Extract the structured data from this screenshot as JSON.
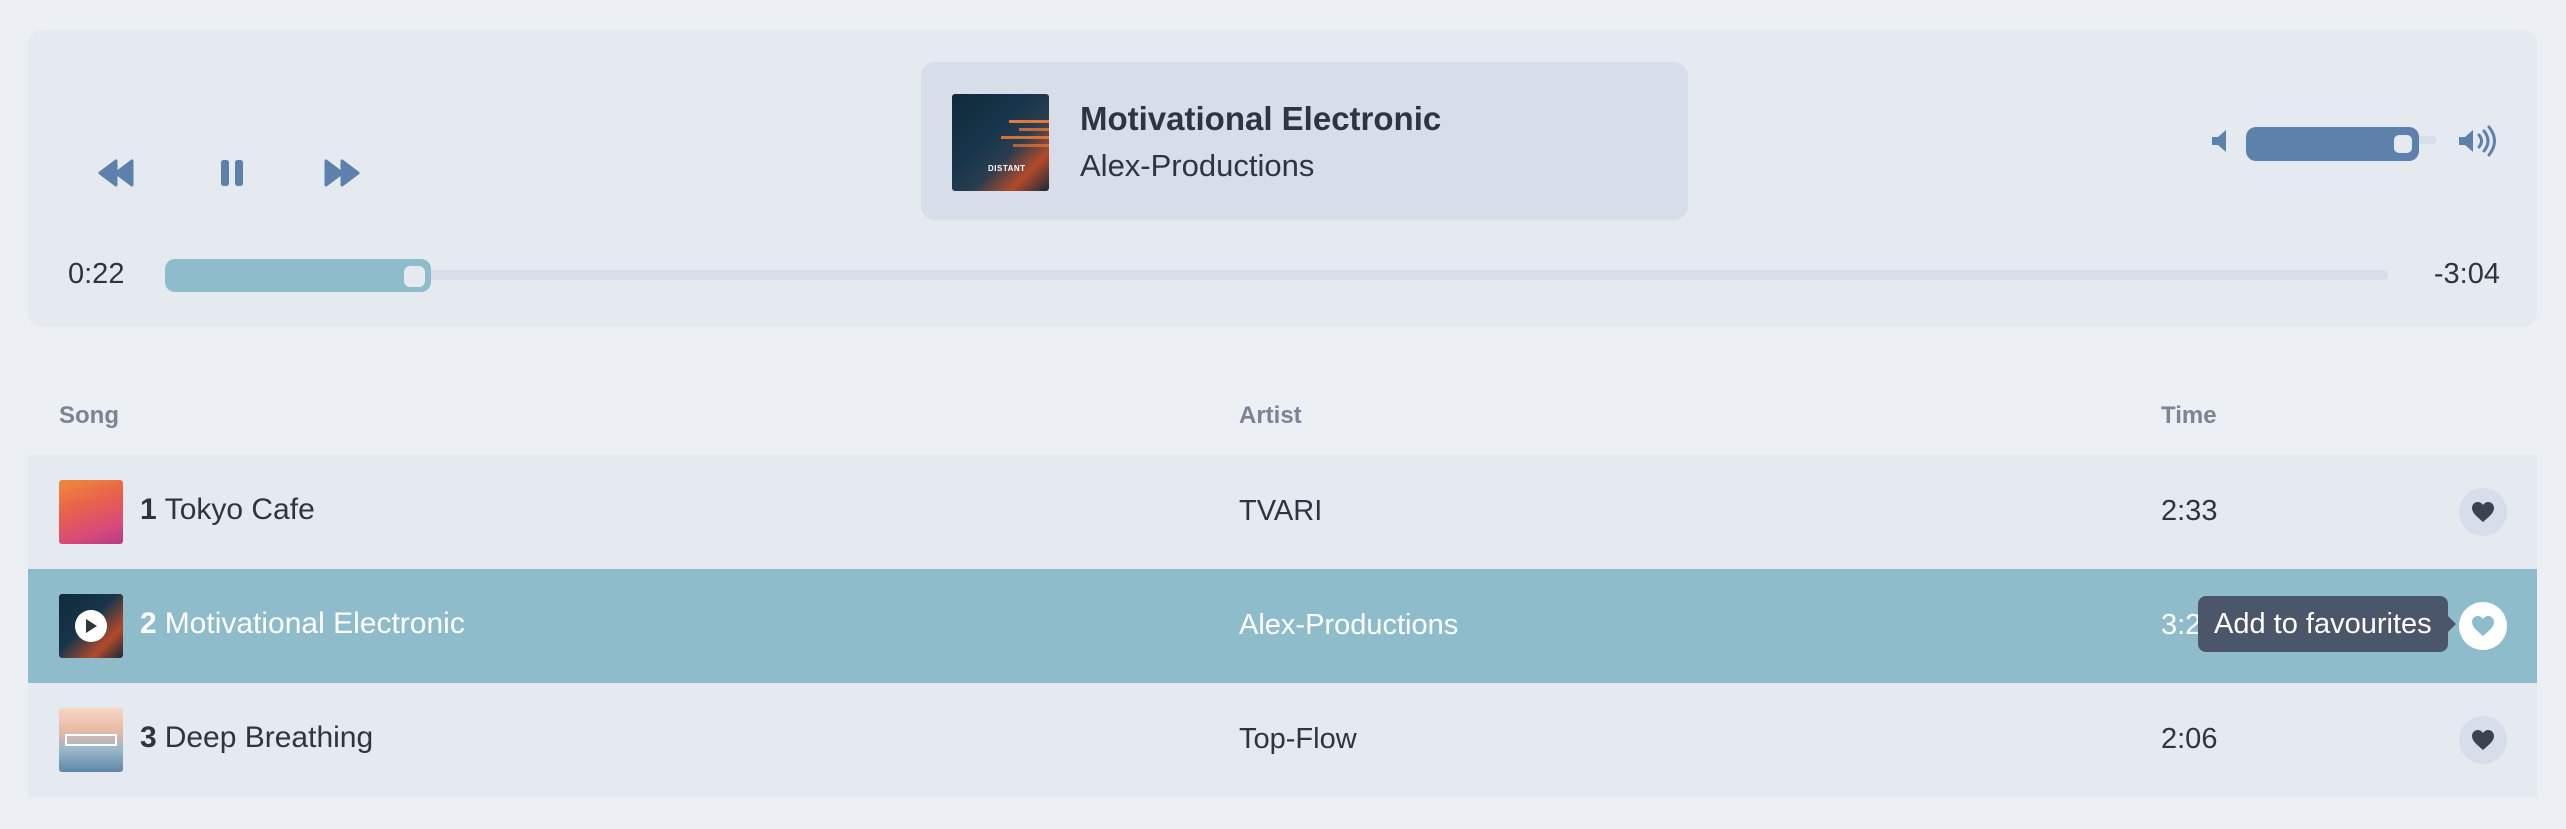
{
  "player": {
    "controls": {
      "prev_icon": "rewind-icon",
      "pause_icon": "pause-icon",
      "next_icon": "fast-forward-icon"
    },
    "now_playing": {
      "title": "Motivational Electronic",
      "artist": "Alex-Productions",
      "cover_text": "DISTANT"
    },
    "volume": {
      "level": 0.86,
      "low_icon": "volume-low-icon",
      "high_icon": "volume-high-icon"
    },
    "progress": {
      "elapsed": "0:22",
      "remaining": "-3:04",
      "fraction": 0.107
    }
  },
  "table": {
    "headers": {
      "song": "Song",
      "artist": "Artist",
      "time": "Time"
    },
    "rows": [
      {
        "number": "1",
        "title": "Tokyo Cafe",
        "artist": "TVARI",
        "time": "2:33",
        "active": false
      },
      {
        "number": "2",
        "title": "Motivational Electronic",
        "artist": "Alex-Productions",
        "time": "3:26",
        "active": true
      },
      {
        "number": "3",
        "title": "Deep Breathing",
        "artist": "Top-Flow",
        "time": "2:06",
        "active": false
      }
    ],
    "tooltip": "Add to favourites"
  },
  "colors": {
    "background": "#eceff4",
    "panel": "#e5e9f0",
    "card": "#d8dee9",
    "accent_blue": "#5e81ac",
    "accent_teal": "#8fbccb",
    "text": "#2e3440",
    "muted": "#7b8394",
    "tooltip": "#4c566a"
  }
}
